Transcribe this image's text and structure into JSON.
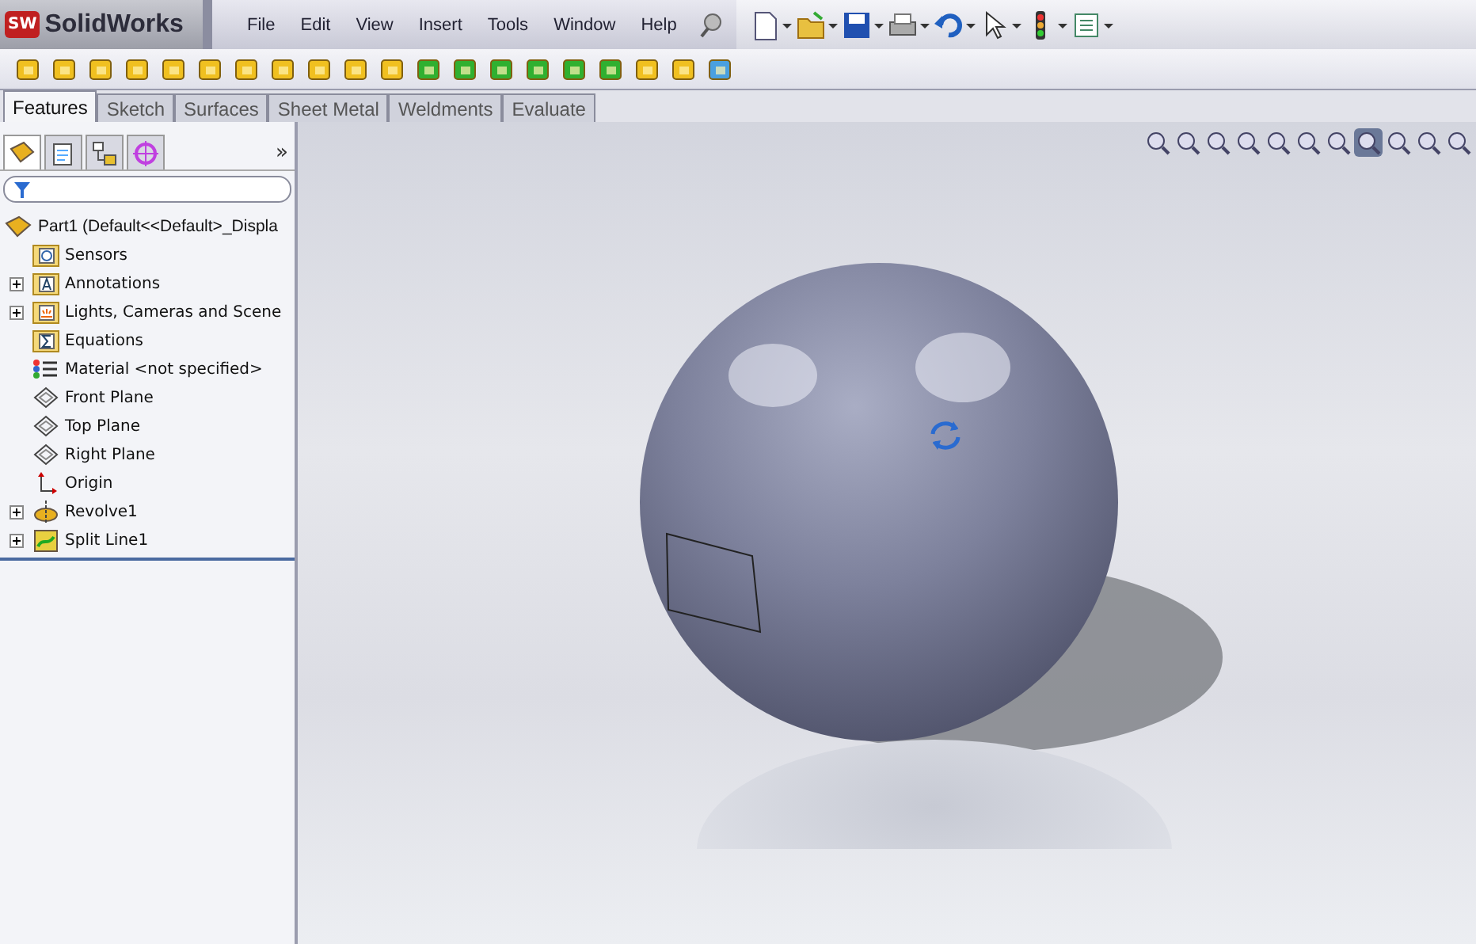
{
  "app": {
    "badge": "SW",
    "name": "SolidWorks"
  },
  "menu": [
    "File",
    "Edit",
    "View",
    "Insert",
    "Tools",
    "Window",
    "Help"
  ],
  "command_tabs": [
    {
      "label": "Features",
      "selected": true
    },
    {
      "label": "Sketch",
      "selected": false
    },
    {
      "label": "Surfaces",
      "selected": false
    },
    {
      "label": "Sheet Metal",
      "selected": false
    },
    {
      "label": "Weldments",
      "selected": false
    },
    {
      "label": "Evaluate",
      "selected": false
    }
  ],
  "panel_tabs": [
    {
      "kind": "tree",
      "selected": true
    },
    {
      "kind": "property",
      "selected": false
    },
    {
      "kind": "config",
      "selected": false
    },
    {
      "kind": "target",
      "selected": false
    }
  ],
  "panel_more": "»",
  "tree": {
    "root": {
      "label": "Part1  (Default<<Default>_Displa"
    },
    "items": [
      {
        "label": "Sensors",
        "kind": "sensors",
        "collapsed": false
      },
      {
        "label": "Annotations",
        "kind": "annotations",
        "collapsed": true
      },
      {
        "label": "Lights, Cameras and Scene",
        "kind": "lights",
        "collapsed": true
      },
      {
        "label": "Equations",
        "kind": "equations",
        "collapsed": false
      },
      {
        "label": "Material <not specified>",
        "kind": "material",
        "collapsed": false
      },
      {
        "label": "Front Plane",
        "kind": "plane",
        "collapsed": false
      },
      {
        "label": "Top Plane",
        "kind": "plane",
        "collapsed": false
      },
      {
        "label": "Right Plane",
        "kind": "plane",
        "collapsed": false
      },
      {
        "label": "Origin",
        "kind": "origin",
        "collapsed": false
      },
      {
        "label": "Revolve1",
        "kind": "revolve",
        "collapsed": true
      },
      {
        "label": "Split Line1",
        "kind": "split",
        "collapsed": true
      }
    ]
  }
}
